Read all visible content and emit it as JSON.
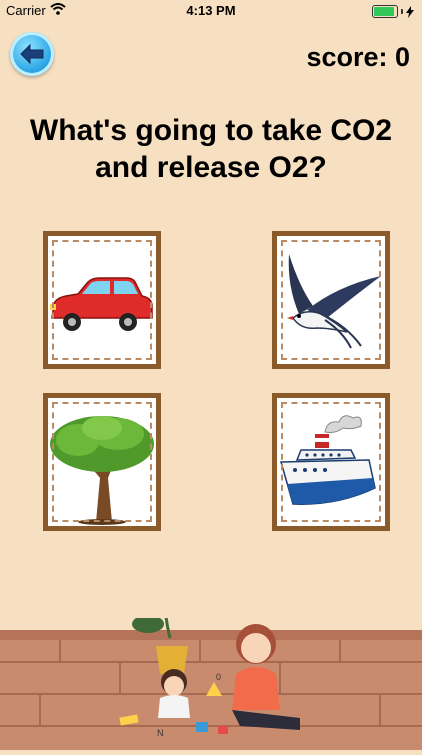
{
  "status": {
    "carrier": "Carrier",
    "time": "4:13 PM"
  },
  "header": {
    "score": "score: 0"
  },
  "question": {
    "line1": "What's going to take CO2",
    "line2": "and release O2?"
  },
  "choices": [
    {
      "name": "car",
      "icon": "car-icon"
    },
    {
      "name": "bird",
      "icon": "swallow-bird-icon"
    },
    {
      "name": "tree",
      "icon": "tree-icon"
    },
    {
      "name": "ship",
      "icon": "ship-icon"
    }
  ],
  "scene": {
    "letters": [
      "N",
      "0"
    ]
  },
  "colors": {
    "background": "#f7dfc1",
    "card_frame": "#8a5a2b",
    "back_button": "#2fa8e6"
  }
}
